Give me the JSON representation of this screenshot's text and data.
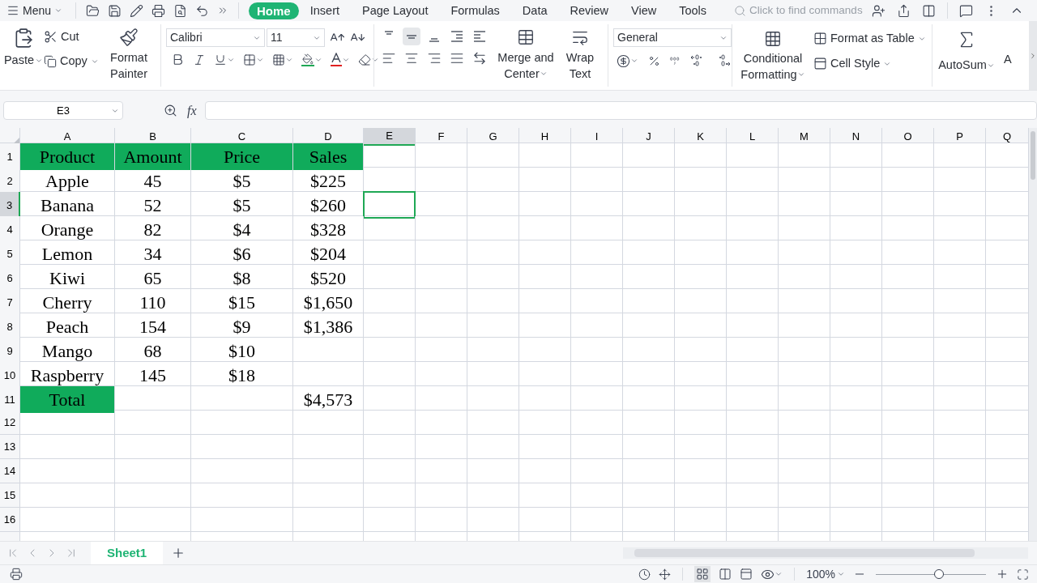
{
  "top_bar": {
    "menu": "Menu",
    "tabs": [
      {
        "label": "Home",
        "selected": true
      },
      {
        "label": "Insert",
        "selected": false
      },
      {
        "label": "Page Layout",
        "selected": false
      },
      {
        "label": "Formulas",
        "selected": false
      },
      {
        "label": "Data",
        "selected": false
      },
      {
        "label": "Review",
        "selected": false
      },
      {
        "label": "View",
        "selected": false
      },
      {
        "label": "Tools",
        "selected": false
      }
    ],
    "search": {
      "placeholder": "Click to find commands"
    }
  },
  "ribbon": {
    "paste": "Paste",
    "cut": "Cut",
    "copy": "Copy",
    "format_painter": [
      "Format",
      "Painter"
    ],
    "font": "Calibri",
    "font_size": "11",
    "merge": [
      "Merge and",
      "Center"
    ],
    "wrap": [
      "Wrap",
      "Text"
    ],
    "number_format": "General",
    "conditional": [
      "Conditional",
      "Formatting"
    ],
    "format_as_table": "Format as Table",
    "cell_style": "Cell Style",
    "autosum": "AutoSum",
    "cut_off": "A"
  },
  "name_box": "E3",
  "fx": "fx",
  "sheet": {
    "columns": [
      {
        "label": "A",
        "selected": false
      },
      {
        "label": "B",
        "selected": false
      },
      {
        "label": "C",
        "selected": false
      },
      {
        "label": "D",
        "selected": false
      },
      {
        "label": "E",
        "selected": true
      },
      {
        "label": "F",
        "selected": false
      },
      {
        "label": "G",
        "selected": false
      },
      {
        "label": "H",
        "selected": false
      },
      {
        "label": "I",
        "selected": false
      },
      {
        "label": "J",
        "selected": false
      },
      {
        "label": "K",
        "selected": false
      },
      {
        "label": "L",
        "selected": false
      },
      {
        "label": "M",
        "selected": false
      },
      {
        "label": "N",
        "selected": false
      },
      {
        "label": "O",
        "selected": false
      },
      {
        "label": "P",
        "selected": false
      },
      {
        "label": "Q",
        "selected": false
      }
    ],
    "rows": [
      {
        "number": "1",
        "selected": false,
        "cells": [
          {
            "text": "Product",
            "filled": true
          },
          {
            "text": "Amount",
            "filled": true
          },
          {
            "text": "Price",
            "filled": true
          },
          {
            "text": "Sales",
            "filled": true
          }
        ]
      },
      {
        "number": "2",
        "selected": false,
        "cells": [
          {
            "text": "Apple",
            "filled": false
          },
          {
            "text": "45",
            "filled": false
          },
          {
            "text": "$5",
            "filled": false
          },
          {
            "text": "$225",
            "filled": false
          }
        ]
      },
      {
        "number": "3",
        "selected": true,
        "cells": [
          {
            "text": "Banana",
            "filled": false
          },
          {
            "text": "52",
            "filled": false
          },
          {
            "text": "$5",
            "filled": false
          },
          {
            "text": "$260",
            "filled": false
          }
        ]
      },
      {
        "number": "4",
        "selected": false,
        "cells": [
          {
            "text": "Orange",
            "filled": false
          },
          {
            "text": "82",
            "filled": false
          },
          {
            "text": "$4",
            "filled": false
          },
          {
            "text": "$328",
            "filled": false
          }
        ]
      },
      {
        "number": "5",
        "selected": false,
        "cells": [
          {
            "text": "Lemon",
            "filled": false
          },
          {
            "text": "34",
            "filled": false
          },
          {
            "text": "$6",
            "filled": false
          },
          {
            "text": "$204",
            "filled": false
          }
        ]
      },
      {
        "number": "6",
        "selected": false,
        "cells": [
          {
            "text": "Kiwi",
            "filled": false
          },
          {
            "text": "65",
            "filled": false
          },
          {
            "text": "$8",
            "filled": false
          },
          {
            "text": "$520",
            "filled": false
          }
        ]
      },
      {
        "number": "7",
        "selected": false,
        "cells": [
          {
            "text": "Cherry",
            "filled": false
          },
          {
            "text": "110",
            "filled": false
          },
          {
            "text": "$15",
            "filled": false
          },
          {
            "text": "$1,650",
            "filled": false
          }
        ]
      },
      {
        "number": "8",
        "selected": false,
        "cells": [
          {
            "text": "Peach",
            "filled": false
          },
          {
            "text": "154",
            "filled": false
          },
          {
            "text": "$9",
            "filled": false
          },
          {
            "text": "$1,386",
            "filled": false
          }
        ]
      },
      {
        "number": "9",
        "selected": false,
        "cells": [
          {
            "text": "Mango",
            "filled": false
          },
          {
            "text": "68",
            "filled": false
          },
          {
            "text": "$10",
            "filled": false
          },
          {
            "filled": false
          }
        ]
      },
      {
        "number": "10",
        "selected": false,
        "cells": [
          {
            "text": "Raspberry",
            "filled": false
          },
          {
            "text": "145",
            "filled": false
          },
          {
            "text": "$18",
            "filled": false
          },
          {
            "filled": false
          }
        ]
      },
      {
        "number": "11",
        "selected": false,
        "cells": [
          {
            "text": "Total",
            "filled": true
          },
          {
            "filled": false
          },
          {
            "filled": false
          },
          {
            "text": "$4,573",
            "filled": false
          }
        ]
      },
      {
        "number": "12",
        "selected": false,
        "cells": []
      },
      {
        "number": "13",
        "selected": false,
        "cells": []
      },
      {
        "number": "14",
        "selected": false,
        "cells": []
      },
      {
        "number": "15",
        "selected": false,
        "cells": []
      },
      {
        "number": "16",
        "selected": false,
        "cells": []
      }
    ]
  },
  "sheet_tabs": [
    {
      "label": "Sheet1",
      "selected": true
    }
  ],
  "status_bar": {
    "zoom": "100%",
    "zoom_slider": {
      "level": 0.57
    }
  }
}
